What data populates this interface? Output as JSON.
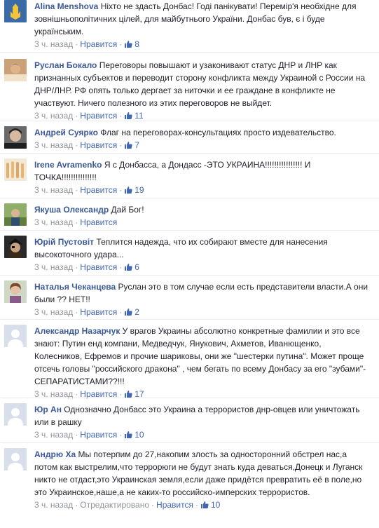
{
  "comments": [
    {
      "author": "Alina Menshova",
      "text": "Ніхто не здасть Донбас! Годі панікувати! Перемір'я необхідне для зовнішньополітичних цілей, для майбутнього України. Донбас був, є і буде українським.",
      "time": "3 ч. назад",
      "like_label": "Нравится",
      "likes": "8"
    },
    {
      "author": "Руслан Бокало",
      "text": "Переговоры повышают и узаконивают статус ДНР и ЛНР как признанных субъектов и переводит сторону конфликта между Украиной с России на ДНР/ЛНР. РФ опять только дергает за ниточки и ее граждане в конфликте не участвуют. Ничего полезного из этих переговоров не выйдет.",
      "time": "3 ч. назад",
      "like_label": "Нравится",
      "likes": "11"
    },
    {
      "author": "Андрей Суярко",
      "text": "Флаг на переговорах-консультациях просто издевательство.",
      "time": "3 ч. назад",
      "like_label": "Нравится",
      "likes": "7"
    },
    {
      "author": "Irene Avramenko",
      "text": "Я с Донбасса, а Дондасс -ЭТО УКРАИНА!!!!!!!!!!!!!!!! И ТОЧКА!!!!!!!!!!!!!!!",
      "time": "3 ч. назад",
      "like_label": "Нравится",
      "likes": "19"
    },
    {
      "author": "Якуша Олександр",
      "text": "Дай Бог!",
      "time": "3 ч. назад",
      "like_label": "Нравится",
      "likes": ""
    },
    {
      "author": "Юрій Пустовіт",
      "text": "Теплится надежда, что их собирают вместе для нанесения высокоточного удара...",
      "time": "3 ч. назад",
      "like_label": "Нравится",
      "likes": "6"
    },
    {
      "author": "Наталья Чеканцева",
      "text": "Руслан это в том случае если есть представители власти.А они были ?? НЕТ!!",
      "time": "3 ч. назад",
      "like_label": "Нравится",
      "likes": "2"
    },
    {
      "author": "Александр Назарчук",
      "text": "У врагов Украины абсолютно конкретные фамилии и это все знают: Путин енд компани, Медведчук, Янукович, Ахметов, Иванющенко, Колесников, Ефремов и прочие шариковы, они же \"шестерки путина\". Может проще отсечь головы \"российского дракона\" , чем бегать по всему Донбасу за его \"зубами\"-СЕПАРАТИСТАМИ??!!!",
      "time": "3 ч. назад",
      "like_label": "Нравится",
      "likes": "17"
    },
    {
      "author": "Юр Ан",
      "text": "Однозначно Донбасс это Украина а террористов днр-овцев или уничтожать или в рашку",
      "time": "3 ч. назад",
      "like_label": "Нравится",
      "likes": "10"
    },
    {
      "author": "Андрю Ха",
      "text": "Мы потерпим до 27,накопим злость за односторонний обстрел нас,а потом как выстрелим,что террорюги не будут знать куда деваться,Донецк и Луганск никто не отдаст,это Украинская земля,если даже придётся превратить её в поле,но это Украинское,наше,а не каких-то российско-имперских террористов.",
      "time": "3 ч. назад",
      "edited": "Отредактировано",
      "like_label": "Нравится",
      "likes": "10"
    }
  ],
  "colors": {
    "author": "#3b5998",
    "like": "#4267b2",
    "meta": "#90949c",
    "separator": "#e9ebee"
  },
  "icons": {
    "like": "thumbs-up-icon"
  }
}
